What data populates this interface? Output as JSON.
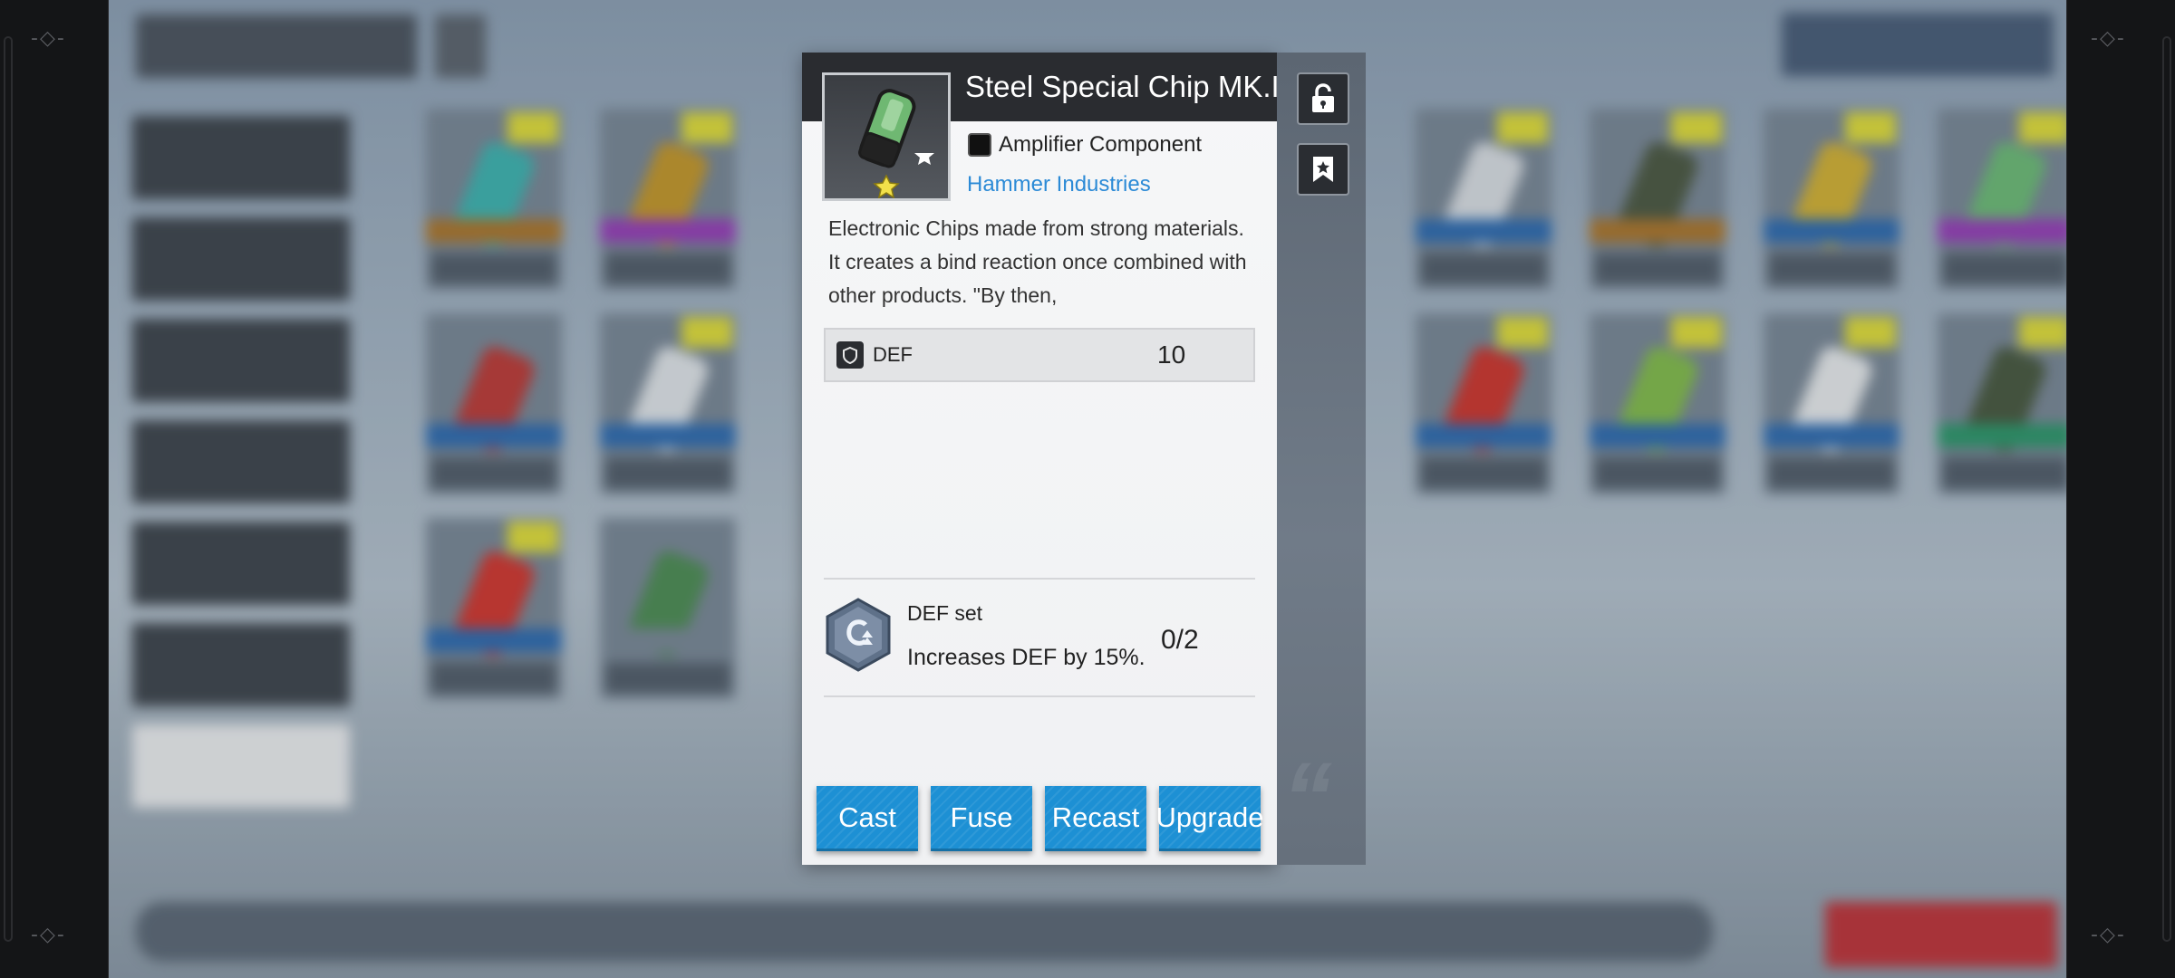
{
  "item": {
    "name": "Steel Special Chip MK.I",
    "type": "Amplifier Component",
    "manufacturer": "Hammer Industries",
    "description": "Electronic Chips made from strong materials. It creates a bind reaction once combined with other products. \"By then,",
    "icon": "chip-icon",
    "stats": [
      {
        "name": "DEF",
        "value": "10",
        "icon": "shield-icon"
      }
    ],
    "set_bonus": {
      "name": "DEF set",
      "effect": "Increases DEF by 15%.",
      "progress": "0/2",
      "icon": "set-badge-icon"
    }
  },
  "actions": {
    "cast": "Cast",
    "fuse": "Fuse",
    "recast": "Recast",
    "upgrade": "Upgrade"
  },
  "side_buttons": {
    "lock_icon": "lock-icon",
    "bookmark_icon": "bookmark-icon"
  },
  "colors": {
    "accent_button": "#1d90d4",
    "manufacturer_link": "#2b8ad6",
    "panel_header": "#2a2c30",
    "background_dismantle": "#c4343a",
    "rarity_tag": "#e6e23a"
  }
}
